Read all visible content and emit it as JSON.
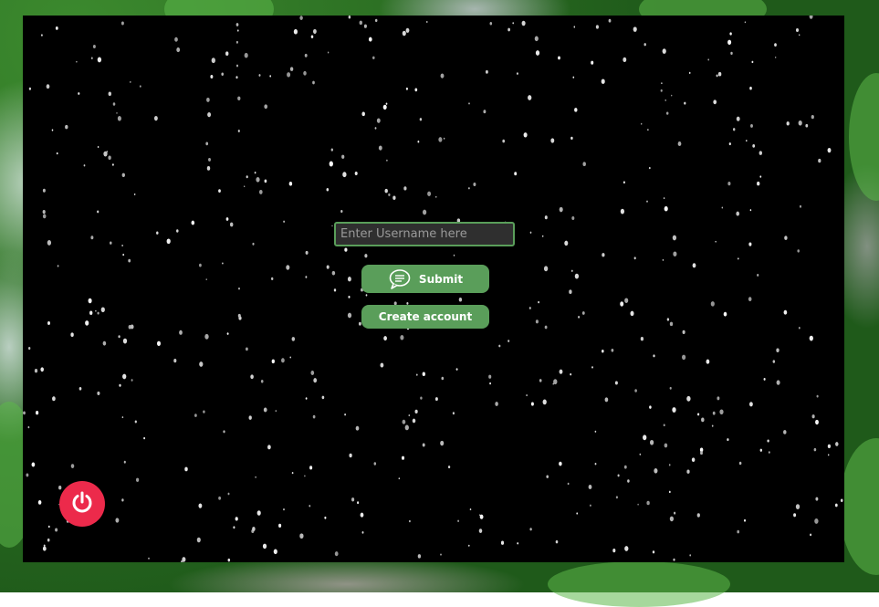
{
  "login": {
    "username_placeholder": "Enter Username here",
    "username_value": "",
    "submit_label": "Submit",
    "submit_icon": "chat-bubble-icon",
    "create_account_label": "Create account"
  },
  "power": {
    "icon": "power-icon"
  },
  "colors": {
    "button": "#5a9e5a",
    "input_border": "#5a9e5a",
    "power": "#ec2a4b",
    "panel": "#000000"
  }
}
